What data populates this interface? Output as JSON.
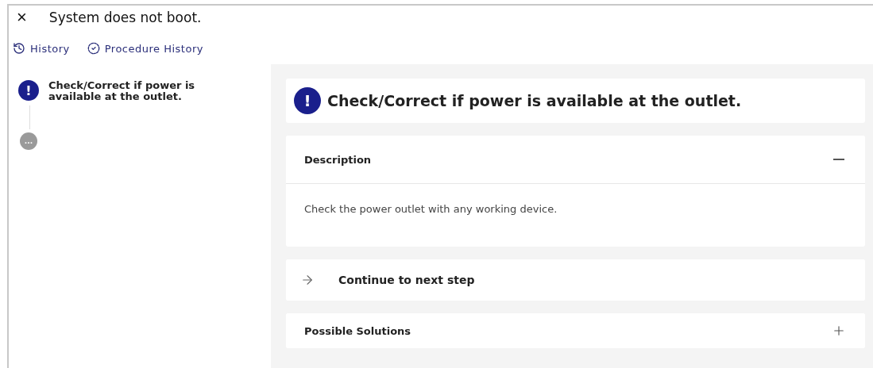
{
  "header": {
    "close": "×",
    "title": "System does not boot."
  },
  "links": [
    {
      "kind": "history",
      "label": "History"
    },
    {
      "kind": "procedure",
      "label": "Procedure History"
    }
  ],
  "steps": [
    {
      "kind": "alert",
      "symbol": "!",
      "label": "Check/Correct if power is available at the outlet."
    },
    {
      "kind": "pending",
      "symbol": "..."
    }
  ],
  "detail": {
    "symbol": "!",
    "title": "Check/Correct if power is available at the outlet.",
    "sections": [
      {
        "kind": "accordion",
        "title": "Description",
        "expanded": true,
        "body": "Check the power outlet with any working device."
      },
      {
        "kind": "action",
        "title": "Continue to next step"
      },
      {
        "kind": "accordion",
        "title": "Possible Solutions",
        "expanded": false
      }
    ]
  }
}
